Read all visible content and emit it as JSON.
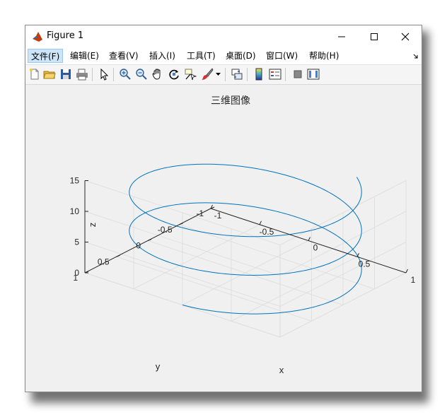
{
  "window": {
    "title": "Figure 1",
    "controls": {
      "minimize": "minimize-icon",
      "maximize": "maximize-icon",
      "close": "close-icon"
    }
  },
  "menu": {
    "items": [
      "文件(F)",
      "编辑(E)",
      "查看(V)",
      "插入(I)",
      "工具(T)",
      "桌面(D)",
      "窗口(W)",
      "帮助(H)"
    ],
    "active_index": 0
  },
  "toolbar": {
    "icons": [
      "new-figure-icon",
      "open-file-icon",
      "save-icon",
      "print-icon",
      "edit-plot-icon",
      "zoom-in-icon",
      "zoom-out-icon",
      "pan-icon",
      "rotate-3d-icon",
      "data-cursor-icon",
      "brush-icon",
      "brush-dropdown-icon",
      "link-plot-icon",
      "colorbar-icon",
      "legend-icon",
      "hide-plot-tools-icon",
      "show-plot-tools-icon"
    ]
  },
  "plot": {
    "title": "三维图像",
    "x_label": "x",
    "y_label": "y",
    "z_label": "z",
    "x_ticks": [
      "-1",
      "-0.5",
      "0",
      "0.5",
      "1"
    ],
    "y_ticks": [
      "-1",
      "-0.5",
      "0",
      "0.5",
      "1"
    ],
    "z_ticks": [
      "0",
      "5",
      "10",
      "15"
    ],
    "line_color": "#0072bd"
  },
  "chart_data": {
    "type": "line",
    "title": "三维图像",
    "xlabel": "x",
    "ylabel": "y",
    "zlabel": "z",
    "xlim": [
      -1,
      1
    ],
    "ylim": [
      -1,
      1
    ],
    "zlim": [
      0,
      15
    ],
    "grid": true,
    "series": [
      {
        "x_expr": "sin(t)",
        "y_expr": "cos(t)",
        "z_expr": "t",
        "t_range": [
          0,
          15
        ],
        "color": "#0072bd"
      }
    ]
  }
}
